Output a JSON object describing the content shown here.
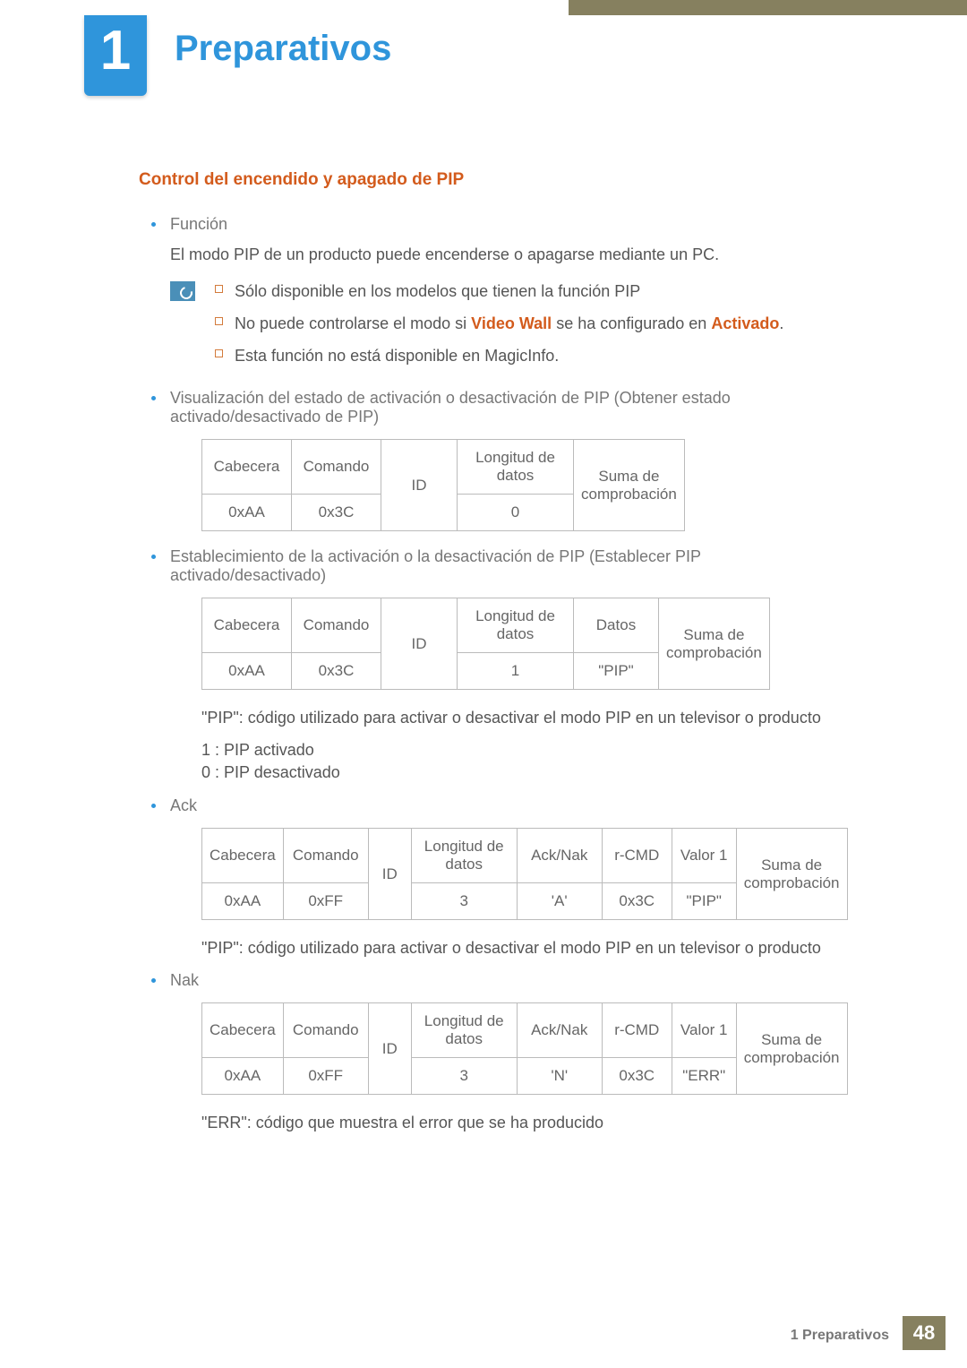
{
  "chapter": {
    "number": "1",
    "title": "Preparativos"
  },
  "section": {
    "heading": "Control del encendido y apagado de PIP"
  },
  "funcion": {
    "label": "Función",
    "desc": "El modo PIP de un producto puede encenderse o apagarse mediante un PC.",
    "notes": {
      "n1": "Sólo disponible en los modelos que tienen la función PIP",
      "n2a": "No puede controlarse el modo si ",
      "n2b": "Video Wall",
      "n2c": " se ha configurado en ",
      "n2d": "Activado",
      "n2e": ".",
      "n3": "Esta función no está disponible en MagicInfo."
    }
  },
  "vis": {
    "label": "Visualización del estado de activación o desactivación de PIP (Obtener estado activado/desactivado de PIP)",
    "t": {
      "h1": "Cabecera",
      "h2": "Comando",
      "h3": "ID",
      "h4": "Longitud de datos",
      "h5": "Suma de comprobación",
      "v1": "0xAA",
      "v2": "0x3C",
      "v4": "0"
    }
  },
  "set": {
    "label": "Establecimiento de la activación o la desactivación de PIP (Establecer PIP activado/desactivado)",
    "t": {
      "h1": "Cabecera",
      "h2": "Comando",
      "h3": "ID",
      "h4": "Longitud de datos",
      "h5": "Datos",
      "h6": "Suma de comprobación",
      "v1": "0xAA",
      "v2": "0x3C",
      "v4": "1",
      "v5": "\"PIP\""
    },
    "note1": "\"PIP\": código utilizado para activar o desactivar el modo PIP en un televisor o producto",
    "note2": "1 : PIP activado",
    "note3": "0 : PIP desactivado"
  },
  "ack": {
    "label": "Ack",
    "t": {
      "h1": "Cabecera",
      "h2": "Comando",
      "h3": "ID",
      "h4": "Longitud de datos",
      "h5": "Ack/Nak",
      "h6": "r-CMD",
      "h7": "Valor 1",
      "h8": "Suma de comprobación",
      "v1": "0xAA",
      "v2": "0xFF",
      "v4": "3",
      "v5": "'A'",
      "v6": "0x3C",
      "v7": "\"PIP\""
    },
    "note": "\"PIP\": código utilizado para activar o desactivar el modo PIP en un televisor o producto"
  },
  "nak": {
    "label": "Nak",
    "t": {
      "h1": "Cabecera",
      "h2": "Comando",
      "h3": "ID",
      "h4": "Longitud de datos",
      "h5": "Ack/Nak",
      "h6": "r-CMD",
      "h7": "Valor 1",
      "h8": "Suma de comprobación",
      "v1": "0xAA",
      "v2": "0xFF",
      "v4": "3",
      "v5": "'N'",
      "v6": "0x3C",
      "v7": "\"ERR\""
    },
    "note": "\"ERR\": código que muestra el error que se ha producido"
  },
  "footer": {
    "label": "1 Preparativos",
    "page": "48"
  }
}
